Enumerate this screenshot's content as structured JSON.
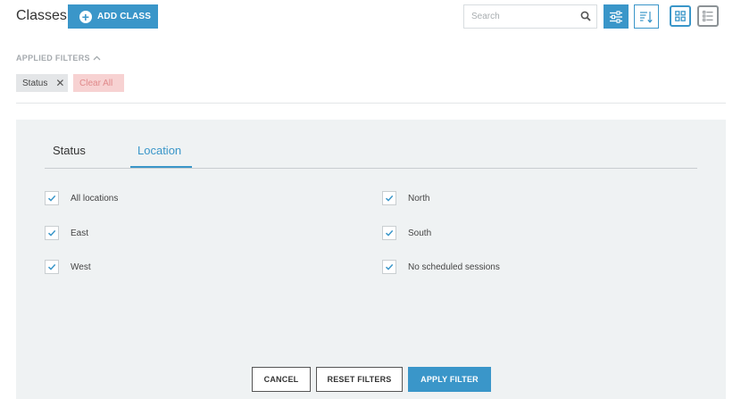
{
  "header": {
    "title": "Classes",
    "add_button_label": "ADD CLASS",
    "search_placeholder": "Search"
  },
  "applied_filters": {
    "label": "APPLIED FILTERS",
    "chips": [
      {
        "label": "Status"
      }
    ],
    "clear_all_label": "Clear All"
  },
  "filter_panel": {
    "tabs": [
      {
        "label": "Status",
        "active": false
      },
      {
        "label": "Location",
        "active": true
      }
    ],
    "options": [
      {
        "label": "All locations",
        "checked": true
      },
      {
        "label": "East",
        "checked": true
      },
      {
        "label": "West",
        "checked": true
      },
      {
        "label": "North",
        "checked": true
      },
      {
        "label": "South",
        "checked": true
      },
      {
        "label": "No scheduled sessions",
        "checked": true
      }
    ],
    "buttons": {
      "cancel": "CANCEL",
      "reset": "RESET FILTERS",
      "apply": "APPLY FILTER"
    }
  },
  "colors": {
    "accent": "#3a96c9",
    "panel_bg": "#eff2f3",
    "clear_chip_bg": "#f7d2d2",
    "clear_chip_text": "#e0898a"
  },
  "icons": [
    "plus-circle-icon",
    "search-icon",
    "filter-sliders-icon",
    "sort-icon",
    "grid-view-icon",
    "list-view-icon",
    "chevron-up-icon",
    "close-icon",
    "checkmark-icon"
  ]
}
